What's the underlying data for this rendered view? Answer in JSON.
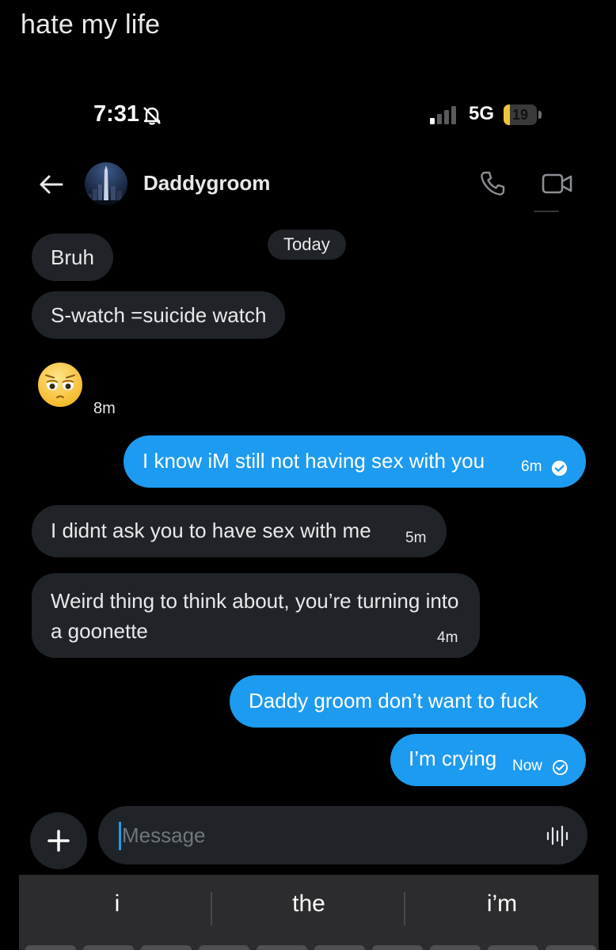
{
  "caption": "hate my life",
  "status": {
    "time": "7:31",
    "network": "5G",
    "battery": "19",
    "battery_level": 0.19,
    "icons": [
      "bell-slash-icon",
      "signal-icon",
      "battery-icon"
    ]
  },
  "header": {
    "contact_name": "Daddygroom",
    "icons": [
      "back-arrow-icon",
      "phone-icon",
      "video-camera-icon"
    ]
  },
  "date_divider": "Today",
  "messages": {
    "m1": {
      "text": "Bruh"
    },
    "m2": {
      "text": "S-watch =suicide watch"
    },
    "m3": {
      "text": "😩",
      "time": "8m"
    },
    "m4": {
      "text": "I know iM still not having sex with you",
      "time": "6m",
      "status": "read"
    },
    "m5": {
      "text": "I didnt ask you to have sex with me",
      "time": "5m"
    },
    "m6": {
      "text": "Weird thing to think about, you’re turning into a goonette",
      "time": "4m"
    },
    "m7": {
      "text": "Daddy groom don’t want to fuck"
    },
    "m8": {
      "text": "I’m crying",
      "time": "Now",
      "status": "sent"
    }
  },
  "composer": {
    "placeholder": "Message",
    "icons": [
      "plus-icon",
      "voice-waveform-icon"
    ]
  },
  "keyboard": {
    "suggestions": [
      "i",
      "the",
      "i’m"
    ]
  },
  "colors": {
    "sent_bubble": "#1d9bf0",
    "received_bubble": "#202327",
    "battery_fill": "#f0c33c"
  }
}
